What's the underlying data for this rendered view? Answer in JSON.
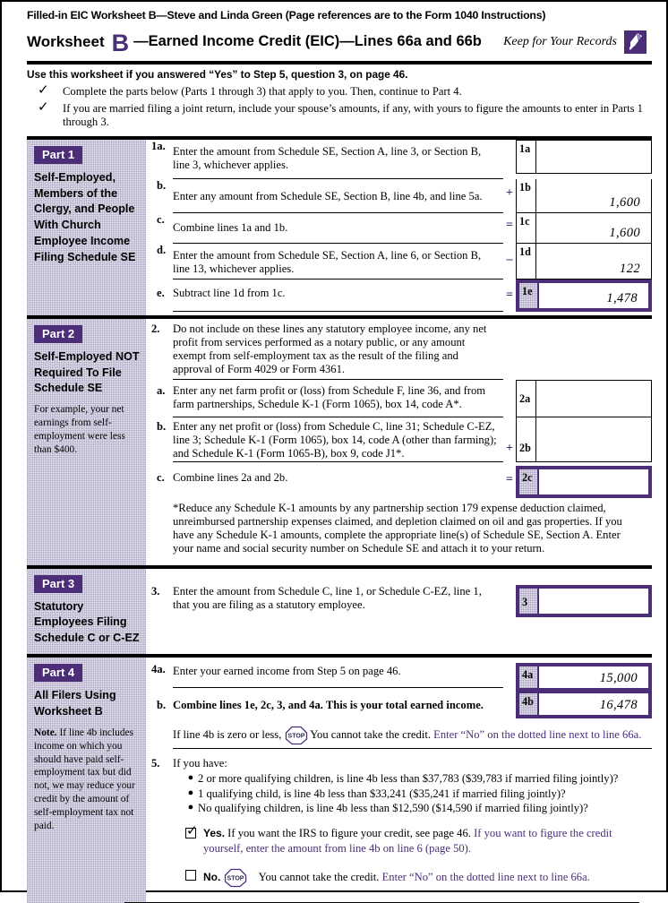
{
  "header": {
    "doc_title": "Filled-in EIC Worksheet B—Steve and Linda Green (Page references are to the Form 1040 Instructions)",
    "worksheet_word": "Worksheet",
    "worksheet_letter": "B",
    "worksheet_rest": "—Earned Income Credit (EIC)—Lines 66a and 66b",
    "keep_label": "Keep for Your Records",
    "keep_icon": "pen-icon"
  },
  "instructions": {
    "use_line": "Use this worksheet if you answered “Yes” to Step 5, question 3, on page 46.",
    "checks": [
      "Complete the parts below (Parts 1 through 3) that apply to you. Then, continue to Part 4.",
      "If you are married filing a joint return, include your spouse’s amounts, if any, with yours to figure the amounts to enter in Parts 1 through 3."
    ],
    "tick_glyph": "✓"
  },
  "colors": {
    "accent_purple": "#4b2d78",
    "sidebar_gray": "#e9e9ef",
    "text_black": "#000000"
  },
  "part1": {
    "badge": "Part 1",
    "heading": "Self-Employed, Members of the Clergy, and People With Church Employee Income Filing Schedule SE",
    "lines": [
      {
        "num": "1a.",
        "text": "Enter the amount from Schedule SE, Section A, line 3, or Section B, line 3, whichever applies.",
        "op": "",
        "label": "1a",
        "value": ""
      },
      {
        "num": "b.",
        "text": "Enter any amount from Schedule SE, Section B, line 4b, and line 5a.",
        "op": "+",
        "label": "1b",
        "value": "1,600"
      },
      {
        "num": "c.",
        "text": "Combine lines 1a and 1b.",
        "op": "=",
        "label": "1c",
        "value": "1,600"
      },
      {
        "num": "d.",
        "text": "Enter the amount from Schedule SE, Section A, line 6, or Section B, line 13, whichever applies.",
        "op": "–",
        "label": "1d",
        "value": "122"
      },
      {
        "num": "e.",
        "text": "Subtract line 1d from 1c.",
        "op": "=",
        "label": "1e",
        "value": "1,478"
      }
    ]
  },
  "part2": {
    "badge": "Part 2",
    "heading": "Self-Employed NOT Required To File Schedule SE",
    "note": "For example, your net earnings from self-employment were less than $400.",
    "intro_num": "2.",
    "intro_text": "Do not include on these lines any statutory employee income, any net profit from services performed as a notary public, or any amount exempt from self-employment tax as the result of the filing and approval of Form 4029 or Form 4361.",
    "lines": [
      {
        "num": "a.",
        "text": "Enter any net farm profit or (loss) from Schedule F, line 36, and from farm partnerships, Schedule K-1 (Form 1065), box 14, code A*.",
        "op": "",
        "label": "2a",
        "value": ""
      },
      {
        "num": "b.",
        "text": "Enter any net profit or (loss) from Schedule C, line 31; Schedule C-EZ, line 3; Schedule K-1 (Form 1065), box 14, code A (other than farming); and Schedule K-1 (Form 1065-B), box 9, code J1*.",
        "op": "+",
        "label": "2b",
        "value": ""
      },
      {
        "num": "c.",
        "text": "Combine lines 2a and 2b.",
        "op": "=",
        "label": "2c",
        "value": ""
      }
    ],
    "footnote": "*Reduce any Schedule K-1 amounts by any partnership section 179 expense deduction claimed, unreimbursed partnership expenses claimed, and depletion claimed on oil and gas properties. If you have any Schedule K-1 amounts, complete the appropriate line(s) of Schedule SE, Section A. Enter your name and social security number on Schedule SE and attach it to your return."
  },
  "part3": {
    "badge": "Part 3",
    "heading": "Statutory Employees Filing Schedule C or C-EZ",
    "line": {
      "num": "3.",
      "text": "Enter the amount from Schedule C, line 1, or Schedule C-EZ, line 1, that you are filing as a statutory employee.",
      "label": "3",
      "value": ""
    }
  },
  "part4": {
    "badge": "Part 4",
    "heading": "All Filers Using Worksheet B",
    "note_bold": "Note.",
    "note": " If line 4b includes income on which you should have paid self-employment tax but did not, we may reduce your credit by the amount of self-employment tax not paid.",
    "line4a": {
      "num": "4a.",
      "text": "Enter your earned income from Step 5 on page 46.",
      "label": "4a",
      "value": "15,000"
    },
    "line4b": {
      "num": "b.",
      "text_bold_part": "Combine lines 1e, 2c, 3, and 4a. ",
      "text_bold": "This is your total earned income.",
      "label": "4b",
      "value": "16,478"
    },
    "stop_line": {
      "pre": "If line 4b is zero or less,",
      "stop_icon": "stop-sign-icon",
      "stop_word": "STOP",
      "mid": "You cannot take the credit.",
      "purple": "Enter “No” on the dotted line next to line 66a."
    },
    "q5_num": "5.",
    "q5_text": "If you have:",
    "bullets": [
      "2 or more qualifying children, is line 4b less than $37,783 ($39,783 if married filing jointly)?",
      "1 qualifying child, is line 4b less than $33,241 ($35,241 if married filing jointly)?",
      "No qualifying children, is line 4b less than $12,590 ($14,590 if married filing jointly)?"
    ],
    "yes": {
      "checked": true,
      "check_glyph": "✓",
      "label": "Yes.",
      "text": " If you want the IRS to figure your credit, see page 46.",
      "purple": " If you want to figure the credit yourself, enter the amount from line 4b on line 6 (page 50)."
    },
    "no": {
      "checked": false,
      "label": "No.",
      "stop_word": "STOP",
      "text": "You cannot take the credit.",
      "purple": " Enter “No” on the dotted line next to line 66a."
    }
  }
}
